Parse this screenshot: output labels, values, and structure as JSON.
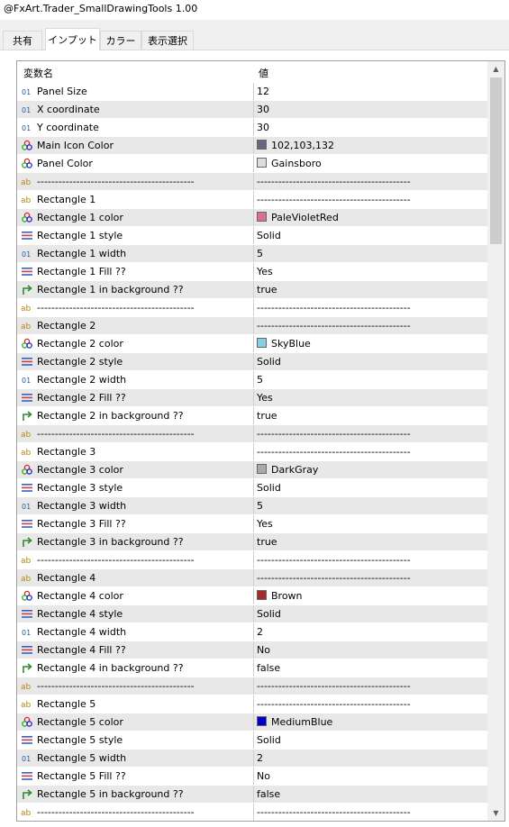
{
  "window": {
    "title": "@FxArt.Trader_SmallDrawingTools 1.00"
  },
  "tabs": [
    {
      "label": "共有"
    },
    {
      "label": "インプット"
    },
    {
      "label": "カラー"
    },
    {
      "label": "表示選択"
    }
  ],
  "grid": {
    "col_name": "変数名",
    "col_value": "値",
    "rows": [
      {
        "icon": "int",
        "name": "Panel Size",
        "value": "12"
      },
      {
        "icon": "int",
        "name": "X coordinate",
        "value": "30"
      },
      {
        "icon": "int",
        "name": "Y coordinate",
        "value": "30"
      },
      {
        "icon": "color",
        "name": "Main Icon Color",
        "value": "102,103,132",
        "swatch": "#666784"
      },
      {
        "icon": "color",
        "name": "Panel Color",
        "value": "Gainsboro",
        "swatch": "#dcdcdc"
      },
      {
        "icon": "string",
        "name": "--------------------------------------------",
        "value": "-------------------------------------------"
      },
      {
        "icon": "string",
        "name": "Rectangle 1",
        "value": "-------------------------------------------"
      },
      {
        "icon": "color",
        "name": "Rectangle 1 color",
        "value": "PaleVioletRed",
        "swatch": "#db7093"
      },
      {
        "icon": "enum",
        "name": "Rectangle 1 style",
        "value": "Solid"
      },
      {
        "icon": "int",
        "name": "Rectangle 1 width",
        "value": "5"
      },
      {
        "icon": "enum",
        "name": "Rectangle 1 Fill ??",
        "value": "Yes"
      },
      {
        "icon": "bool",
        "name": "Rectangle 1 in background ??",
        "value": "true"
      },
      {
        "icon": "string",
        "name": "--------------------------------------------",
        "value": "-------------------------------------------"
      },
      {
        "icon": "string",
        "name": "Rectangle 2",
        "value": "-------------------------------------------"
      },
      {
        "icon": "color",
        "name": "Rectangle 2 color",
        "value": "SkyBlue",
        "swatch": "#87ceeb"
      },
      {
        "icon": "enum",
        "name": "Rectangle 2 style",
        "value": "Solid"
      },
      {
        "icon": "int",
        "name": "Rectangle 2 width",
        "value": "5"
      },
      {
        "icon": "enum",
        "name": "Rectangle 2 Fill ??",
        "value": "Yes"
      },
      {
        "icon": "bool",
        "name": "Rectangle 2 in background ??",
        "value": "true"
      },
      {
        "icon": "string",
        "name": "--------------------------------------------",
        "value": "-------------------------------------------"
      },
      {
        "icon": "string",
        "name": "Rectangle 3",
        "value": "-------------------------------------------"
      },
      {
        "icon": "color",
        "name": "Rectangle 3 color",
        "value": "DarkGray",
        "swatch": "#a9a9a9"
      },
      {
        "icon": "enum",
        "name": "Rectangle 3 style",
        "value": "Solid"
      },
      {
        "icon": "int",
        "name": "Rectangle 3 width",
        "value": "5"
      },
      {
        "icon": "enum",
        "name": "Rectangle 3 Fill ??",
        "value": "Yes"
      },
      {
        "icon": "bool",
        "name": "Rectangle 3 in background ??",
        "value": "true"
      },
      {
        "icon": "string",
        "name": "--------------------------------------------",
        "value": "-------------------------------------------"
      },
      {
        "icon": "string",
        "name": "Rectangle 4",
        "value": "-------------------------------------------"
      },
      {
        "icon": "color",
        "name": "Rectangle 4 color",
        "value": "Brown",
        "swatch": "#a52a2a"
      },
      {
        "icon": "enum",
        "name": "Rectangle 4 style",
        "value": "Solid"
      },
      {
        "icon": "int",
        "name": "Rectangle 4 width",
        "value": "2"
      },
      {
        "icon": "enum",
        "name": "Rectangle 4 Fill ??",
        "value": "No"
      },
      {
        "icon": "bool",
        "name": "Rectangle 4 in background ??",
        "value": "false"
      },
      {
        "icon": "string",
        "name": "--------------------------------------------",
        "value": "-------------------------------------------"
      },
      {
        "icon": "string",
        "name": "Rectangle 5",
        "value": "-------------------------------------------"
      },
      {
        "icon": "color",
        "name": "Rectangle 5 color",
        "value": "MediumBlue",
        "swatch": "#0000cd"
      },
      {
        "icon": "enum",
        "name": "Rectangle 5 style",
        "value": "Solid"
      },
      {
        "icon": "int",
        "name": "Rectangle 5 width",
        "value": "2"
      },
      {
        "icon": "enum",
        "name": "Rectangle 5 Fill ??",
        "value": "No"
      },
      {
        "icon": "bool",
        "name": "Rectangle 5 in background ??",
        "value": "false"
      },
      {
        "icon": "string",
        "name": "--------------------------------------------",
        "value": "-------------------------------------------"
      }
    ]
  },
  "colors": {
    "row_shade": "#e8e8e8",
    "icon_int": "#1f5fa8",
    "icon_string": "#b8860b",
    "icon_bool": "#2e8b2e",
    "icon_enum": "#3a5fcd"
  },
  "icons": {
    "int": "int-type-icon",
    "string": "string-type-icon",
    "color": "color-type-icon",
    "enum": "enum-type-icon",
    "bool": "bool-type-icon",
    "scroll_up": "scroll-up-arrow-icon",
    "scroll_down": "scroll-down-arrow-icon"
  }
}
